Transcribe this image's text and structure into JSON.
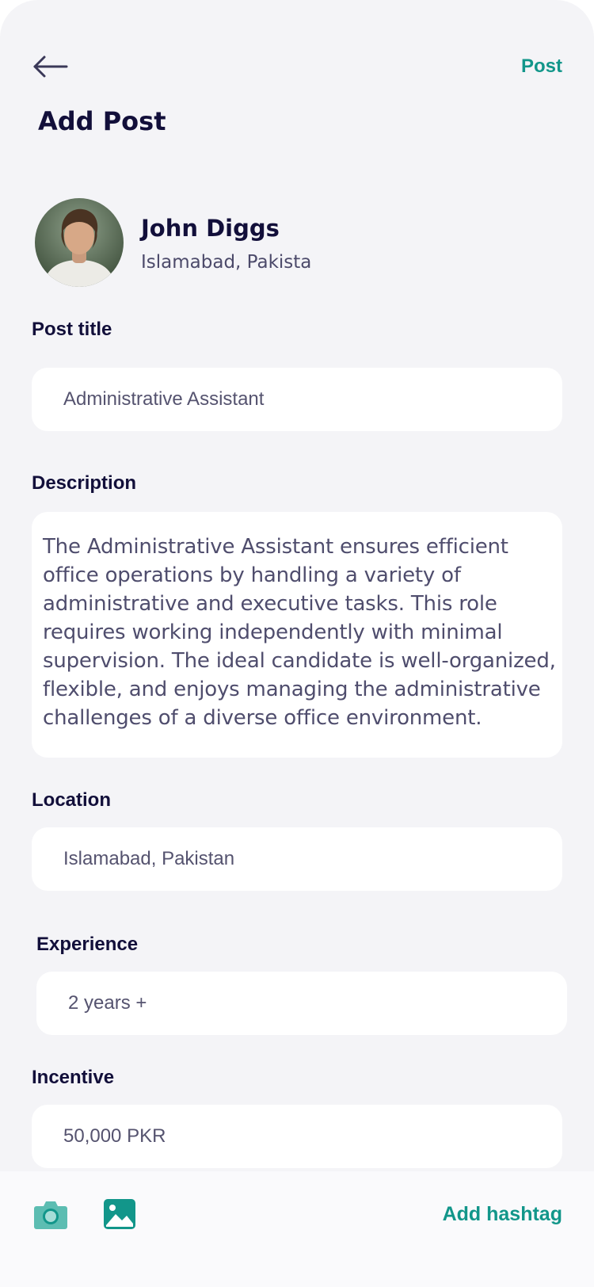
{
  "header": {
    "title": "Add Post",
    "post_label": "Post",
    "back_icon": "arrow-left-icon"
  },
  "author": {
    "name": "John Diggs",
    "location": "Islamabad, Pakista"
  },
  "form": {
    "post_title": {
      "label": "Post title",
      "value": "Administrative Assistant"
    },
    "description": {
      "label": "Description",
      "value": "The Administrative Assistant ensures efficient office operations by handling a variety of administrative and executive tasks. This role requires working independently with minimal supervision. The ideal candidate is well-organized, flexible, and enjoys managing the administrative challenges of a diverse office environment."
    },
    "location": {
      "label": "Location",
      "value": "Islamabad, Pakistan"
    },
    "experience": {
      "label": "Experience",
      "value": "2 years +"
    },
    "incentive": {
      "label": "Incentive",
      "value": "50,000 PKR"
    }
  },
  "toolbar": {
    "camera_icon": "camera-icon",
    "gallery_icon": "image-icon",
    "hashtag_label": "Add hashtag"
  },
  "colors": {
    "accent": "#12968a",
    "title": "#120f3a",
    "background": "#f4f4f7"
  }
}
